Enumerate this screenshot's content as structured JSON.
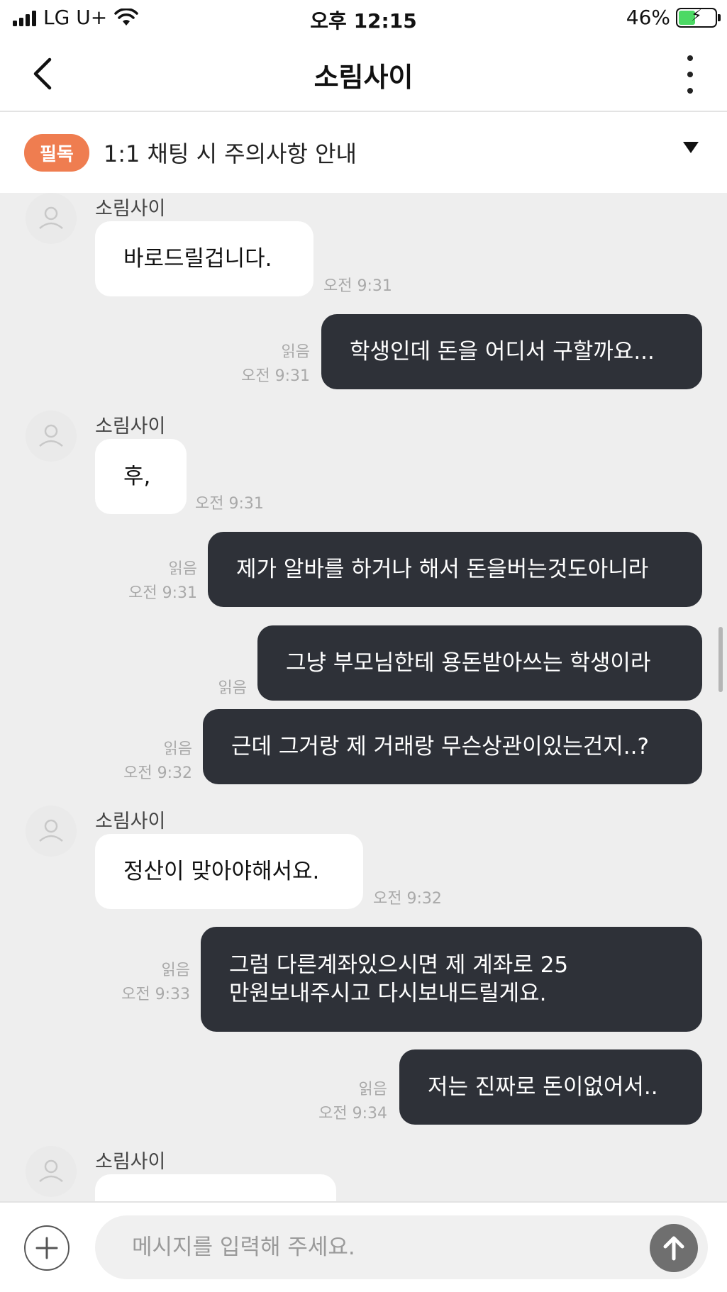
{
  "status_bar": {
    "carrier": "LG U+",
    "time": "오후 12:15",
    "battery": "46%",
    "battery_level": 0.46,
    "icons": [
      "signal-icon",
      "wifi-icon",
      "battery-charging-icon"
    ]
  },
  "header": {
    "title": "소림사이",
    "back_icon": "chevron-left-icon",
    "more_icon": "more-vertical-icon"
  },
  "notice": {
    "badge": "필독",
    "text": "1:1 채팅 시 주의사항 안내",
    "arrow_icon": "triangle-down-icon"
  },
  "messages": [
    {
      "from": "other",
      "sender": "소림사이",
      "lines": [
        "바로드릴겁니다."
      ],
      "time": "오전 9:31"
    },
    {
      "from": "me",
      "lines": [
        "학생인데 돈을 어디서 구할까요..."
      ],
      "read": "읽음",
      "time": "오전 9:31"
    },
    {
      "from": "other",
      "sender": "소림사이",
      "lines": [
        "후,"
      ],
      "time": "오전 9:31"
    },
    {
      "from": "me",
      "lines": [
        "제가 알바를 하거나 해서 돈을버는것도아니라"
      ],
      "read": "읽음",
      "time": "오전 9:31"
    },
    {
      "from": "me",
      "lines": [
        "그냥 부모님한테 용돈받아쓰는 학생이라"
      ],
      "read": "읽음",
      "time": ""
    },
    {
      "from": "me",
      "lines": [
        "근데 그거랑 제 거래랑 무슨상관이있는건지..?"
      ],
      "read": "읽음",
      "time": "오전 9:32"
    },
    {
      "from": "other",
      "sender": "소림사이",
      "lines": [
        "정산이 맞아야해서요."
      ],
      "time": "오전 9:32"
    },
    {
      "from": "me",
      "lines": [
        "그럼 다른계좌있으시면 제 계좌로 25",
        "만원보내주시고 다시보내드릴게요."
      ],
      "read": "읽음",
      "time": "오전 9:33"
    },
    {
      "from": "me",
      "lines": [
        "저는 진짜로 돈이없어서.."
      ],
      "read": "읽음",
      "time": "오전 9:34"
    },
    {
      "from": "other",
      "sender": "소림사이",
      "lines": [
        ""
      ],
      "time": ""
    }
  ],
  "input": {
    "placeholder": "메시지를 입력해 주세요.",
    "value": "",
    "plus_icon": "plus-circle-icon",
    "send_icon": "arrow-up-icon"
  },
  "colors": {
    "accent": "#ef7d50",
    "outgoing_bubble": "#2e3138",
    "incoming_bubble": "#ffffff",
    "chat_background": "#eeeeee",
    "send_button": "#6f6f6f"
  }
}
